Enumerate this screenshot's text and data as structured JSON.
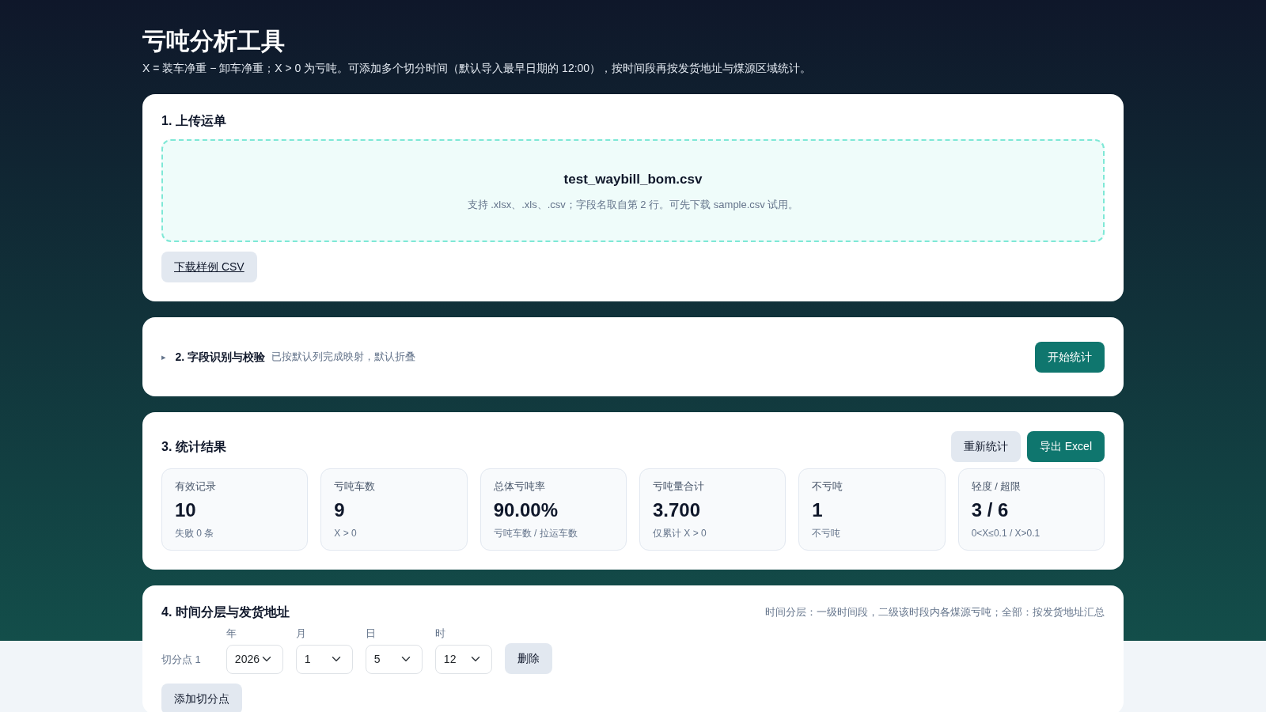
{
  "header": {
    "title": "亏吨分析工具",
    "subtitle": "X = 装车净重 − 卸车净重；X > 0 为亏吨。可添加多个切分时间（默认导入最早日期的 12:00），按时间段再按发货地址与煤源区域统计。"
  },
  "upload": {
    "title": "1. 上传运单",
    "file_name": "test_waybill_bom.csv",
    "hint": "支持 .xlsx、.xls、.csv；字段名取自第 2 行。可先下载 sample.csv 试用。",
    "download_button": "下载样例 CSV"
  },
  "fields": {
    "toggle": "▸",
    "expanded": false,
    "title": "2. 字段识别与校验",
    "note": "已按默认列完成映射，默认折叠",
    "start_button": "开始统计"
  },
  "results": {
    "title": "3. 统计结果",
    "buttons": [
      {
        "label": "重新统计",
        "kind": "secondary"
      },
      {
        "label": "导出 Excel",
        "kind": "primary"
      }
    ],
    "stats": [
      {
        "label": "有效记录",
        "value": "10",
        "note": "失败 0 条"
      },
      {
        "label": "亏吨车数",
        "value": "9",
        "note": "X > 0"
      },
      {
        "label": "总体亏吨率",
        "value": "90.00%",
        "note": "亏吨车数 / 拉运车数"
      },
      {
        "label": "亏吨量合计",
        "value": "3.700",
        "note": "仅累计 X > 0"
      },
      {
        "label": "不亏吨",
        "value": "1",
        "note": "不亏吨"
      },
      {
        "label": "轻度 / 超限",
        "value": "3 / 6",
        "note": "0<X≤0.1 / X>0.1"
      }
    ]
  },
  "time_split": {
    "title": "4. 时间分层与发货地址",
    "note": "时间分层：一级时间段，二级该时段内各煤源亏吨；全部：按发货地址汇总",
    "cut_points": [
      {
        "label": "切分点 1",
        "fields": [
          {
            "label": "年",
            "value": "2026"
          },
          {
            "label": "月",
            "value": "1"
          },
          {
            "label": "日",
            "value": "5"
          },
          {
            "label": "时",
            "value": "12"
          }
        ],
        "delete_button": "删除"
      }
    ],
    "add_button": "添加切分点"
  }
}
